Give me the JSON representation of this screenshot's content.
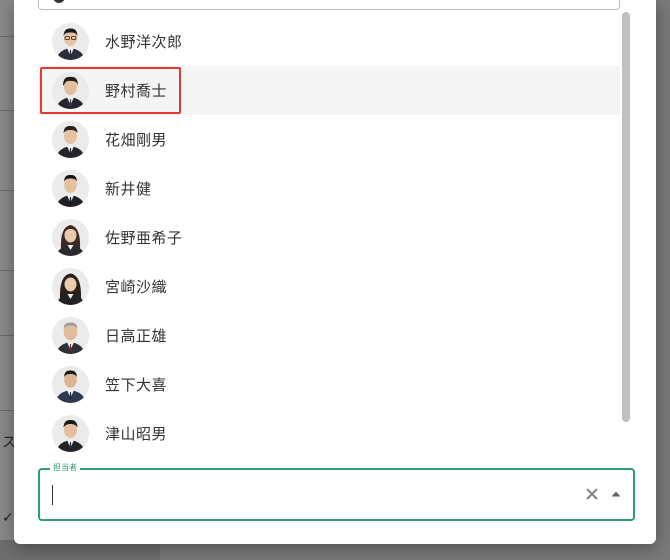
{
  "background": {
    "left_glyphs": [
      "ス",
      "✓"
    ]
  },
  "assignee_dropdown": {
    "options": [
      {
        "name": "水野洋次郎",
        "avatar": "man-suit-glasses-avatar"
      },
      {
        "name": "野村喬士",
        "avatar": "man-suit-avatar",
        "selected": true
      },
      {
        "name": "花畑剛男",
        "avatar": "man-suit-avatar"
      },
      {
        "name": "新井健",
        "avatar": "man-suit-avatar"
      },
      {
        "name": "佐野亜希子",
        "avatar": "woman-suit-avatar"
      },
      {
        "name": "宮崎沙織",
        "avatar": "woman-suit-avatar"
      },
      {
        "name": "日高正雄",
        "avatar": "older-man-suit-avatar"
      },
      {
        "name": "笠下大喜",
        "avatar": "man-suit-avatar"
      },
      {
        "name": "津山昭男",
        "avatar": "man-suit-avatar"
      }
    ]
  },
  "assignee_field": {
    "label": "担当者",
    "value": "",
    "clear_icon": "close-icon",
    "toggle_icon": "arrow-up-icon"
  },
  "colors": {
    "accent": "#2e9c7c",
    "highlight": "#e53935",
    "selected_row": "#f5f5f5"
  }
}
